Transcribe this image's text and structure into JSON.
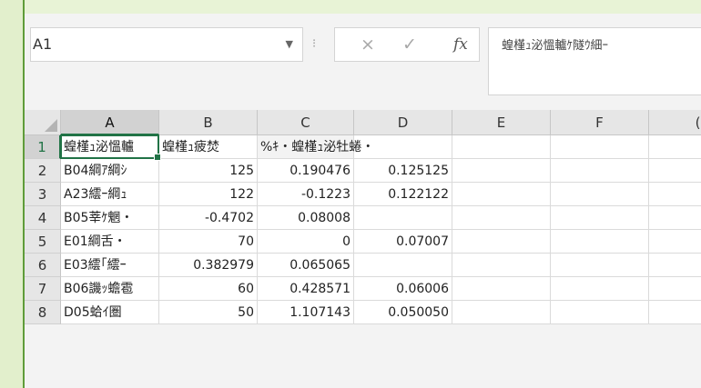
{
  "name_box": {
    "value": "A1"
  },
  "formula_bar": {
    "cancel_icon": "×",
    "enter_icon": "✓",
    "fx_label": "fx",
    "content": "蝗槿ｭ泌慍轤ｹ隧ｳ細ｰ"
  },
  "columns": [
    "A",
    "B",
    "C",
    "D",
    "E",
    "F",
    "("
  ],
  "rows": [
    {
      "num": "1",
      "cells": [
        "蝗槿ｭ泌慍轤",
        "蝗槿ｭ疲焚",
        "%ｷ・蝗槿ｭ泌牡蜷・",
        "",
        "",
        "",
        ""
      ]
    },
    {
      "num": "2",
      "cells": [
        "B04綱ｱ綱ｼ",
        "125",
        "0.190476",
        "0.125125",
        "",
        "",
        ""
      ]
    },
    {
      "num": "3",
      "cells": [
        "A23繧ｰ綱ｭ",
        "122",
        "-0.1223",
        "0.122122",
        "",
        "",
        ""
      ]
    },
    {
      "num": "4",
      "cells": [
        "B05莘ｹ魍・",
        "-0.4702",
        "0.08008",
        "",
        "",
        "",
        ""
      ]
    },
    {
      "num": "5",
      "cells": [
        "E01綱舌・",
        "70",
        "0",
        "0.07007",
        "",
        "",
        ""
      ]
    },
    {
      "num": "6",
      "cells": [
        "E03繧｢繧ｰ",
        "0.382979",
        "0.065065",
        "",
        "",
        "",
        ""
      ]
    },
    {
      "num": "7",
      "cells": [
        "B06譏ｯ蟾雹",
        "60",
        "0.428571",
        "0.06006",
        "",
        "",
        ""
      ]
    },
    {
      "num": "8",
      "cells": [
        "D05蛤ｲ圏",
        "50",
        "1.107143",
        "0.050050",
        "",
        "",
        ""
      ]
    }
  ]
}
